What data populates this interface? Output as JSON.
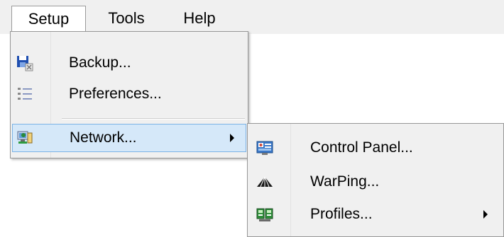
{
  "menubar": {
    "items": [
      {
        "label": "Setup"
      },
      {
        "label": "Tools"
      },
      {
        "label": "Help"
      }
    ]
  },
  "setup_menu": {
    "items": [
      {
        "label": "Backup...",
        "icon": "save-backup-icon"
      },
      {
        "label": "Preferences...",
        "icon": "list-settings-icon"
      },
      {
        "label": "Network...",
        "icon": "network-computer-icon",
        "has_submenu": true,
        "highlighted": true
      }
    ]
  },
  "network_submenu": {
    "items": [
      {
        "label": "Control Panel...",
        "icon": "control-panel-icon"
      },
      {
        "label": "WarPing...",
        "icon": "warping-icon"
      },
      {
        "label": "Profiles...",
        "icon": "profiles-icon",
        "has_submenu": true
      }
    ]
  },
  "colors": {
    "menu_background": "#f0f0f0",
    "highlight_background": "#d5e8f9",
    "highlight_border": "#7bb3e6"
  }
}
